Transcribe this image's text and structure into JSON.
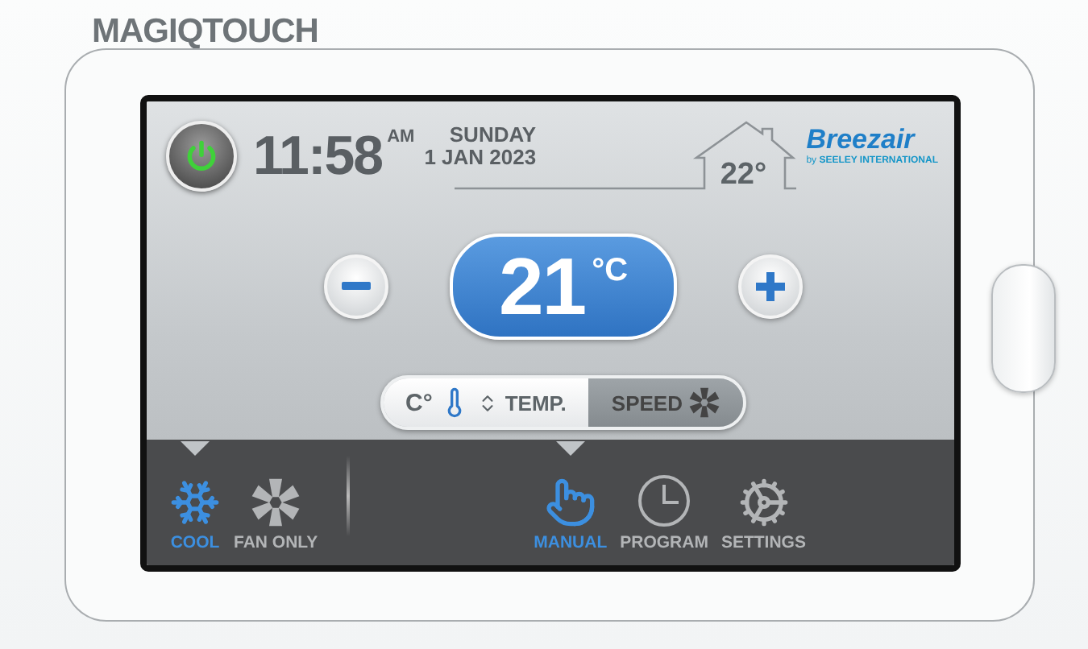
{
  "brand": "MAGIQTOUCH",
  "power": {
    "on": true
  },
  "clock": {
    "time": "11:58",
    "meridiem": "AM",
    "day": "SUNDAY",
    "date": "1 JAN 2023"
  },
  "indoor": {
    "temperature": "22°"
  },
  "logo": {
    "name": "Breezair",
    "byline": "by",
    "company": "SEELEY INTERNATIONAL"
  },
  "setpoint": {
    "value": "21",
    "unit": "°C"
  },
  "adjust_toggle": [
    {
      "kind": "temp",
      "prefix": "C°",
      "label": "TEMP.",
      "selected": true
    },
    {
      "kind": "speed",
      "label": "SPEED",
      "selected": false
    }
  ],
  "modes": [
    {
      "kind": "cool",
      "label": "COOL",
      "selected": true
    },
    {
      "kind": "fan",
      "label": "FAN ONLY",
      "selected": false
    }
  ],
  "controls": [
    {
      "kind": "manual",
      "label": "MANUAL",
      "selected": true
    },
    {
      "kind": "program",
      "label": "PROGRAM",
      "selected": false
    },
    {
      "kind": "settings",
      "label": "SETTINGS",
      "selected": false
    }
  ]
}
